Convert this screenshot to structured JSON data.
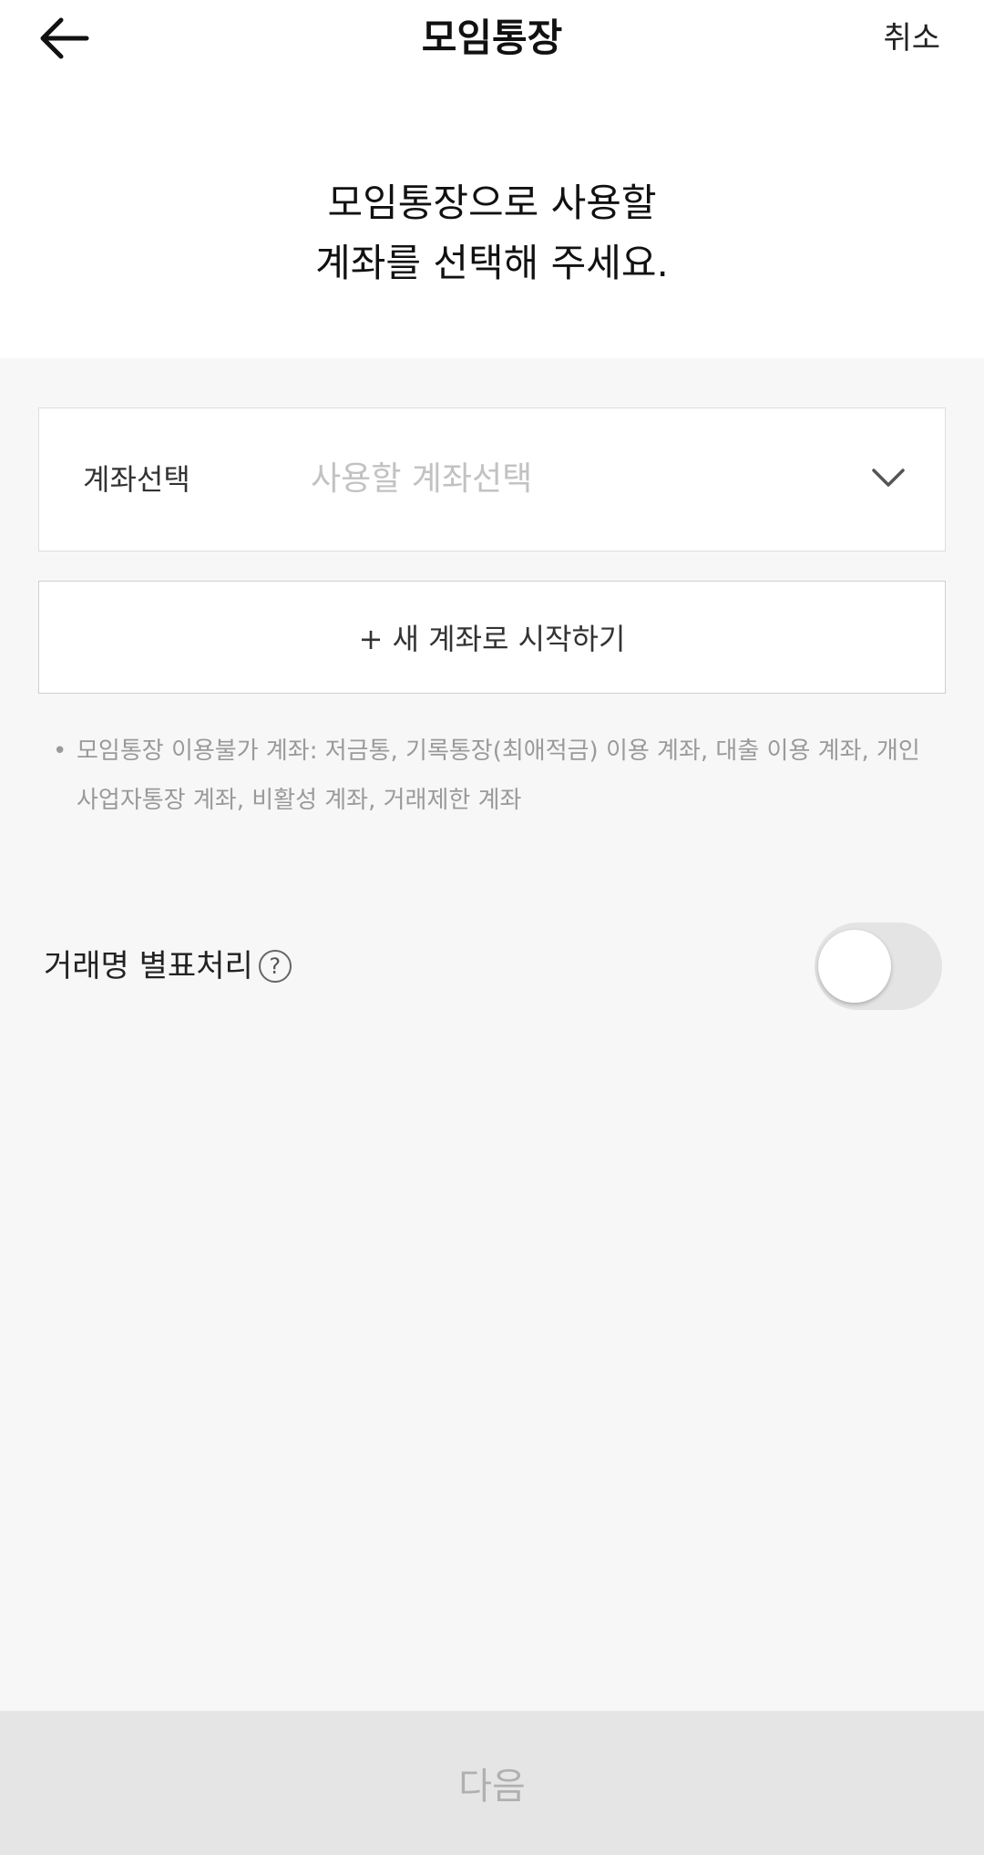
{
  "header": {
    "title": "모임통장",
    "back_icon": "arrow-left-icon",
    "cancel_label": "취소"
  },
  "headline": {
    "line1": "모임통장으로 사용할",
    "line2": "계좌를 선택해 주세요."
  },
  "account_select": {
    "label": "계좌선택",
    "placeholder": "사용할 계좌선택",
    "icon": "chevron-down-icon"
  },
  "new_account": {
    "label": "+ 새 계좌로 시작하기"
  },
  "notice": {
    "bullet": "•",
    "text": "모임통장 이용불가 계좌: 저금통, 기록통장(최애적금) 이용 계좌, 대출 이용 계좌, 개인사업자통장 계좌, 비활성 계좌, 거래제한 계좌"
  },
  "alias_toggle": {
    "label": "거래명 별표처리",
    "help_symbol": "?",
    "enabled": false
  },
  "footer": {
    "next_label": "다음"
  }
}
